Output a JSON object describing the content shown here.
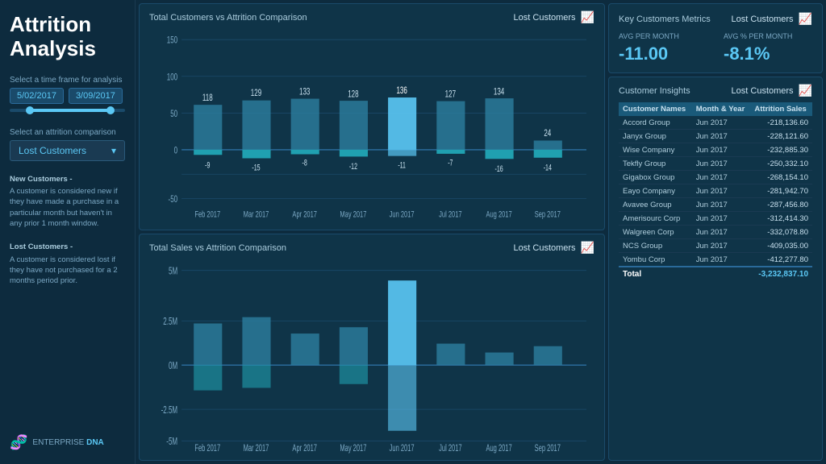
{
  "sidebar": {
    "title": "Attrition\nAnalysis",
    "timeframe_label": "Select a time frame for analysis",
    "date_start": "5/02/2017",
    "date_end": "3/09/2017",
    "attrition_label": "Select an attrition comparison",
    "dropdown_value": "Lost Customers",
    "desc_new_title": "New Customers -",
    "desc_new_text": "A customer is considered new if they have made a purchase in a particular month but haven't in any prior 1 month window.",
    "desc_lost_title": "Lost Customers -",
    "desc_lost_text": "A customer is considered lost if they have not purchased for a 2 months period prior.",
    "footer_label": "ENTERPRISE",
    "footer_sub": "DNA"
  },
  "chart1": {
    "title": "Total Customers vs Attrition Comparison",
    "badge": "Lost Customers",
    "months": [
      "Feb 2017",
      "Mar 2017",
      "Apr 2017",
      "May 2017",
      "Jun 2017",
      "Jul 2017",
      "Aug 2017",
      "Sep 2017"
    ],
    "positive_values": [
      118,
      129,
      133,
      128,
      136,
      127,
      134,
      24
    ],
    "negative_values": [
      -9,
      -15,
      -8,
      -12,
      -11,
      -7,
      -16,
      -14
    ],
    "highlighted_month": "Jun 2017"
  },
  "chart2": {
    "title": "Total Sales vs Attrition Comparison",
    "badge": "Lost Customers",
    "months": [
      "Feb 2017",
      "Mar 2017",
      "Apr 2017",
      "May 2017",
      "Jun 2017",
      "Jul 2017",
      "Aug 2017",
      "Sep 2017"
    ]
  },
  "metrics": {
    "title": "Key Customers Metrics",
    "badge": "Lost Customers",
    "avg_per_month_label": "AVG PER MONTH",
    "avg_per_month_value": "-11.00",
    "avg_pct_label": "AVG % PER MONTH",
    "avg_pct_value": "-8.1%"
  },
  "insights": {
    "title": "Customer Insights",
    "badge": "Lost Customers",
    "columns": [
      "Customer Names",
      "Month & Year",
      "Attrition Sales"
    ],
    "rows": [
      {
        "name": "Accord Group",
        "month": "Jun 2017",
        "value": "-218,136.60"
      },
      {
        "name": "Janyx Group",
        "month": "Jun 2017",
        "value": "-228,121.60"
      },
      {
        "name": "Wise Company",
        "month": "Jun 2017",
        "value": "-232,885.30"
      },
      {
        "name": "Tekfly Group",
        "month": "Jun 2017",
        "value": "-250,332.10"
      },
      {
        "name": "Gigabox Group",
        "month": "Jun 2017",
        "value": "-268,154.10"
      },
      {
        "name": "Eayo Company",
        "month": "Jun 2017",
        "value": "-281,942.70"
      },
      {
        "name": "Avavee Group",
        "month": "Jun 2017",
        "value": "-287,456.80"
      },
      {
        "name": "Amerisourc Corp",
        "month": "Jun 2017",
        "value": "-312,414.30"
      },
      {
        "name": "Walgreen Corp",
        "month": "Jun 2017",
        "value": "-332,078.80"
      },
      {
        "name": "NCS Group",
        "month": "Jun 2017",
        "value": "-409,035.00"
      },
      {
        "name": "Yombu Corp",
        "month": "Jun 2017",
        "value": "-412,277.80"
      }
    ],
    "total_label": "Total",
    "total_value": "-3,232,837.10"
  }
}
